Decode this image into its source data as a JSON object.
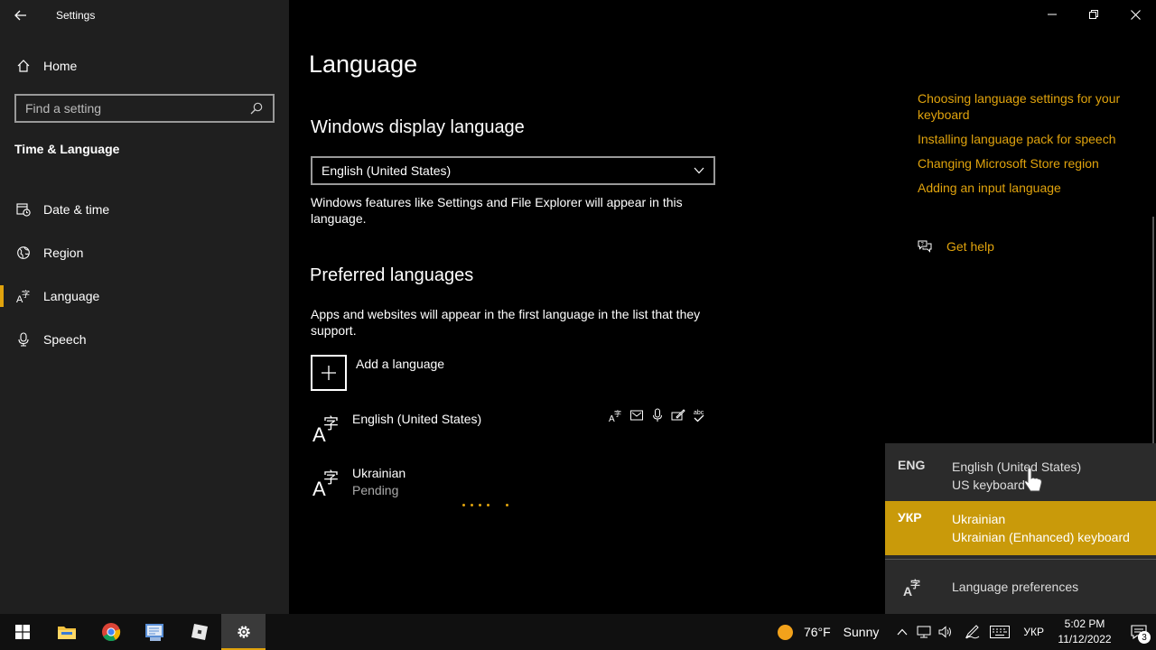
{
  "app": {
    "title": "Settings"
  },
  "sidebar": {
    "home_label": "Home",
    "search_placeholder": "Find a setting",
    "section_title": "Time & Language",
    "items": [
      {
        "label": "Date & time",
        "icon": "calendar-clock-icon",
        "active": false
      },
      {
        "label": "Region",
        "icon": "globe-icon",
        "active": false
      },
      {
        "label": "Language",
        "icon": "language-icon",
        "active": true
      },
      {
        "label": "Speech",
        "icon": "microphone-icon",
        "active": false
      }
    ]
  },
  "main": {
    "title": "Language",
    "display_language": {
      "heading": "Windows display language",
      "selected": "English (United States)",
      "description": "Windows features like Settings and File Explorer will appear in this language."
    },
    "preferred": {
      "heading": "Preferred languages",
      "description": "Apps and websites will appear in the first language in the list that they support.",
      "add_label": "Add a language",
      "languages": [
        {
          "name": "English (United States)",
          "status": ""
        },
        {
          "name": "Ukrainian",
          "status": "Pending"
        }
      ]
    }
  },
  "related": {
    "links": [
      "Choosing language settings for your keyboard",
      "Installing language pack for speech",
      "Changing Microsoft Store region",
      "Adding an input language"
    ],
    "help_label": "Get help"
  },
  "flyout": {
    "items": [
      {
        "code": "ENG",
        "language": "English (United States)",
        "keyboard": "US keyboard",
        "selected": false
      },
      {
        "code": "УКР",
        "language": "Ukrainian",
        "keyboard": "Ukrainian (Enhanced) keyboard",
        "selected": true
      }
    ],
    "preferences_label": "Language preferences"
  },
  "taskbar": {
    "weather_temp": "76°F",
    "weather_condition": "Sunny",
    "input_language": "УКР",
    "time": "5:02 PM",
    "date": "11/12/2022",
    "notification_count": "3"
  },
  "colors": {
    "accent": "#e0a30d",
    "sidebar_bg": "#1f1f1f",
    "flyout_selected": "#c99a0a"
  }
}
